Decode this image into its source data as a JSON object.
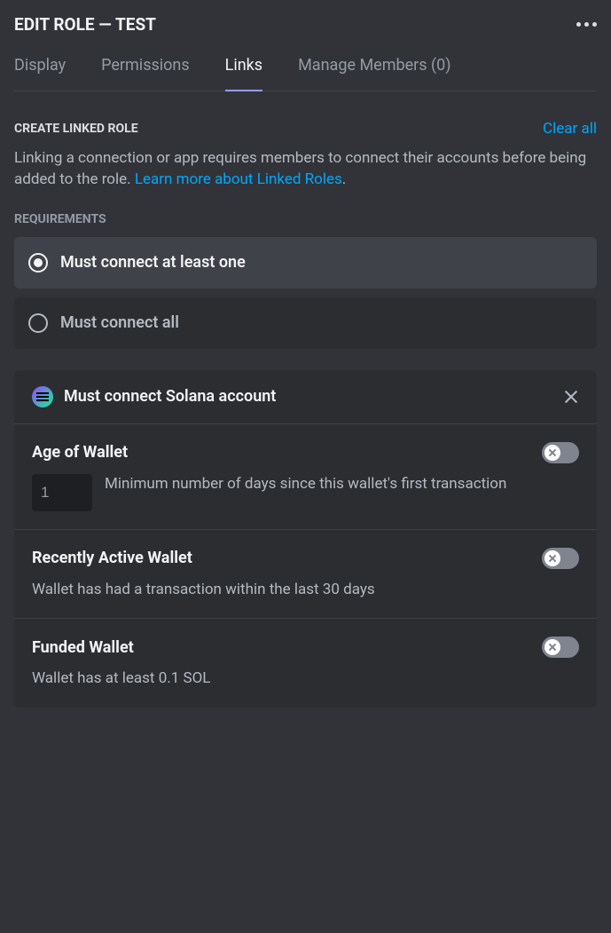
{
  "header": {
    "title": "EDIT ROLE — TEST"
  },
  "tabs": {
    "display": "Display",
    "permissions": "Permissions",
    "links": "Links",
    "manage_members": "Manage Members (0)"
  },
  "section": {
    "title": "CREATE LINKED ROLE",
    "clear_all": "Clear all",
    "description_prefix": "Linking a connection or app requires members to connect their accounts before being added to the role. ",
    "learn_more": "Learn more about Linked Roles",
    "description_suffix": "."
  },
  "requirements": {
    "title": "REQUIREMENTS",
    "option_one": "Must connect at least one",
    "option_all": "Must connect all"
  },
  "connection": {
    "title": "Must connect Solana account",
    "items": [
      {
        "title": "Age of Wallet",
        "input_value": "1",
        "description": "Minimum number of days since this wallet's first transaction"
      },
      {
        "title": "Recently Active Wallet",
        "description": "Wallet has had a transaction within the last 30 days"
      },
      {
        "title": "Funded Wallet",
        "description": "Wallet has at least 0.1 SOL"
      }
    ]
  }
}
